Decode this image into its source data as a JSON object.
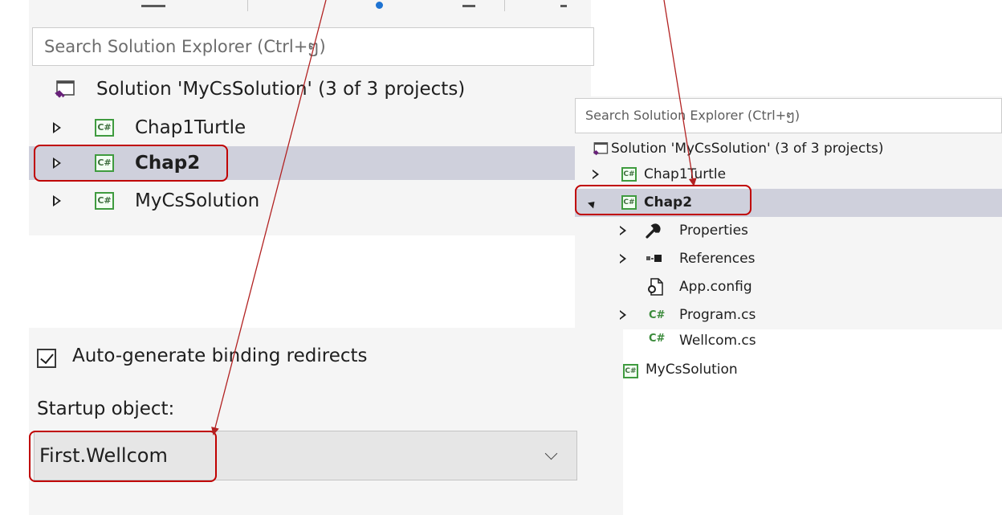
{
  "left_explorer": {
    "search_placeholder": "Search Solution Explorer (Ctrl+ໆ)",
    "solution_label": "Solution 'MyCsSolution' (3 of 3 projects)",
    "projects": [
      {
        "label": "Chap1Turtle",
        "selected": false
      },
      {
        "label": "Chap2",
        "selected": true
      },
      {
        "label": "MyCsSolution",
        "selected": false
      }
    ],
    "cs_badge": "C#"
  },
  "right_explorer": {
    "search_placeholder": "Search Solution Explorer (Ctrl+ໆ)",
    "solution_label": "Solution 'MyCsSolution' (3 of 3 projects)",
    "chap1": "Chap1Turtle",
    "chap2": "Chap2",
    "children": [
      {
        "label": "Properties",
        "icon": "wrench-icon"
      },
      {
        "label": "References",
        "icon": "references-icon"
      },
      {
        "label": "App.config",
        "icon": "config-file-icon"
      },
      {
        "label": "Program.cs",
        "icon": "cs-file-icon"
      },
      {
        "label": "Wellcom.cs",
        "icon": "cs-file-icon"
      }
    ],
    "last_project": "MyCsSolution",
    "cs_badge": "C#",
    "cs_file_glyph": "C#"
  },
  "properties_page": {
    "auto_generate_label": "Auto-generate binding redirects",
    "auto_generate_checked": true,
    "startup_label": "Startup object:",
    "startup_value": "First.Wellcom"
  },
  "colors": {
    "selection": "#cfd0dc",
    "highlight_red": "#c00000",
    "csharp_green": "#3f9b3f",
    "panel_bg": "#f5f5f5"
  }
}
